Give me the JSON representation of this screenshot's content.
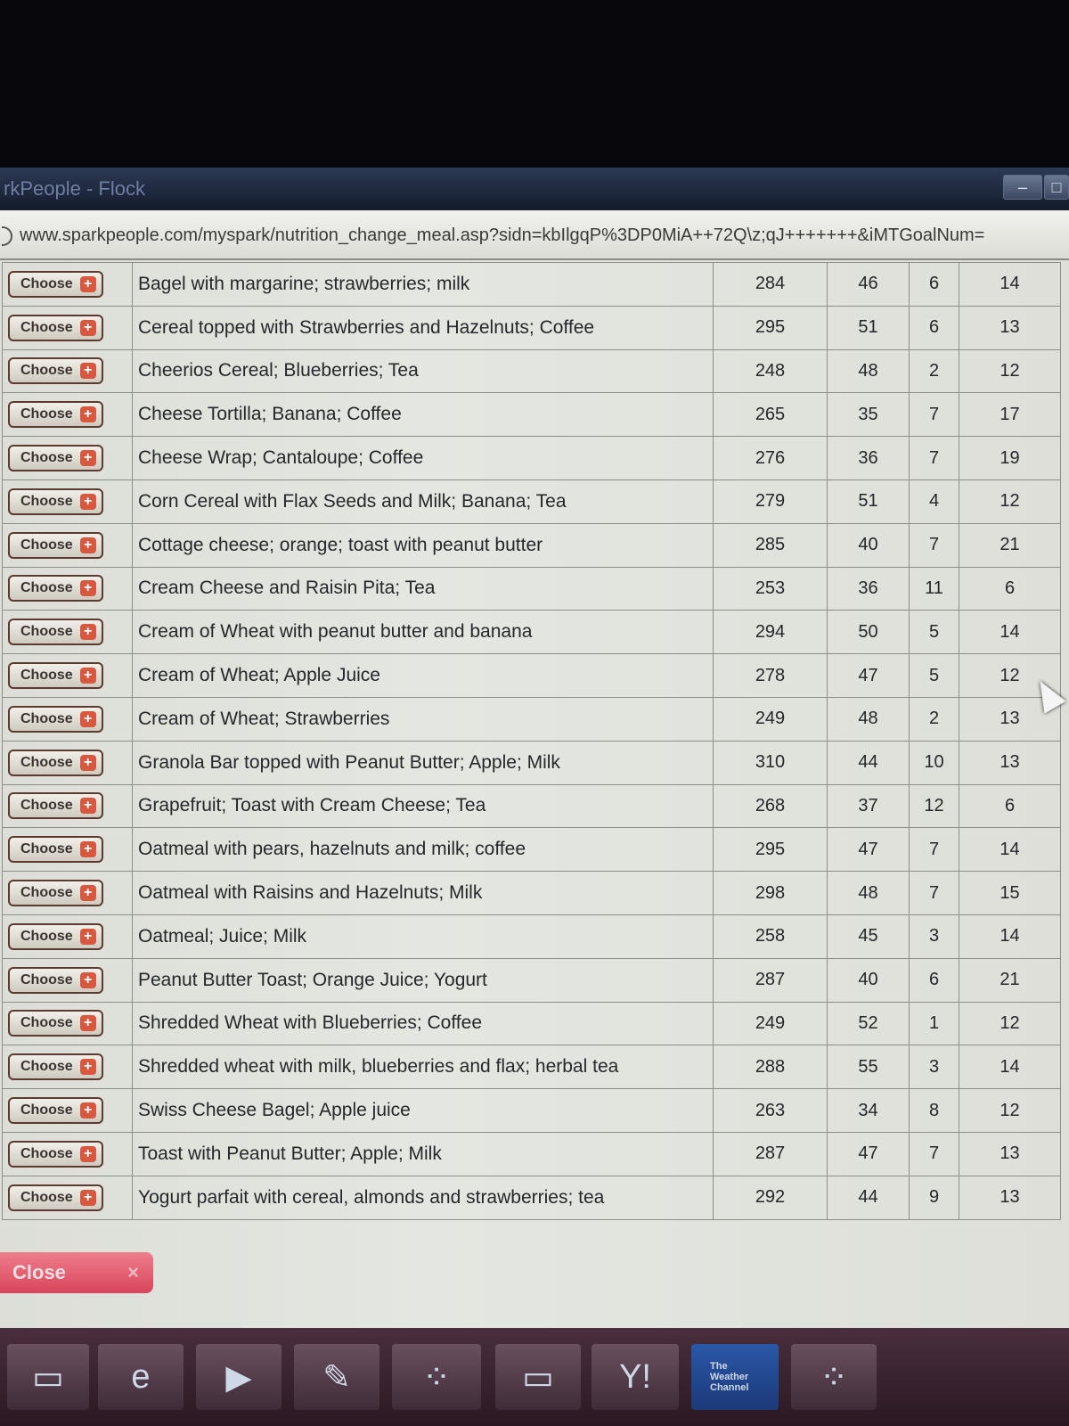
{
  "window": {
    "title": "rkPeople - Flock",
    "controls": [
      "–",
      "□"
    ]
  },
  "address": {
    "url": "www.sparkpeople.com/myspark/nutrition_change_meal.asp?sidn=kbIlgqP%3DP0MiA++72Q\\z;qJ+++++++&iMTGoalNum="
  },
  "table": {
    "choose_label": "Choose",
    "rows": [
      {
        "name": "Bagel with margarine; strawberries; milk",
        "cal": "284",
        "carb": "46",
        "fat": "6",
        "pro": "14"
      },
      {
        "name": "Cereal topped with Strawberries and Hazelnuts; Coffee",
        "cal": "295",
        "carb": "51",
        "fat": "6",
        "pro": "13"
      },
      {
        "name": "Cheerios Cereal; Blueberries; Tea",
        "cal": "248",
        "carb": "48",
        "fat": "2",
        "pro": "12"
      },
      {
        "name": "Cheese Tortilla; Banana; Coffee",
        "cal": "265",
        "carb": "35",
        "fat": "7",
        "pro": "17"
      },
      {
        "name": "Cheese Wrap; Cantaloupe; Coffee",
        "cal": "276",
        "carb": "36",
        "fat": "7",
        "pro": "19"
      },
      {
        "name": "Corn Cereal with Flax Seeds and Milk; Banana; Tea",
        "cal": "279",
        "carb": "51",
        "fat": "4",
        "pro": "12"
      },
      {
        "name": "Cottage cheese; orange; toast with peanut butter",
        "cal": "285",
        "carb": "40",
        "fat": "7",
        "pro": "21"
      },
      {
        "name": "Cream Cheese and Raisin Pita; Tea",
        "cal": "253",
        "carb": "36",
        "fat": "11",
        "pro": "6"
      },
      {
        "name": "Cream of Wheat with peanut butter and banana",
        "cal": "294",
        "carb": "50",
        "fat": "5",
        "pro": "14"
      },
      {
        "name": "Cream of Wheat; Apple Juice",
        "cal": "278",
        "carb": "47",
        "fat": "5",
        "pro": "12"
      },
      {
        "name": "Cream of Wheat; Strawberries",
        "cal": "249",
        "carb": "48",
        "fat": "2",
        "pro": "13"
      },
      {
        "name": "Granola Bar topped with Peanut Butter; Apple; Milk",
        "cal": "310",
        "carb": "44",
        "fat": "10",
        "pro": "13"
      },
      {
        "name": "Grapefruit; Toast with Cream Cheese; Tea",
        "cal": "268",
        "carb": "37",
        "fat": "12",
        "pro": "6"
      },
      {
        "name": "Oatmeal with pears, hazelnuts and milk; coffee",
        "cal": "295",
        "carb": "47",
        "fat": "7",
        "pro": "14"
      },
      {
        "name": "Oatmeal with Raisins and Hazelnuts; Milk",
        "cal": "298",
        "carb": "48",
        "fat": "7",
        "pro": "15"
      },
      {
        "name": "Oatmeal; Juice; Milk",
        "cal": "258",
        "carb": "45",
        "fat": "3",
        "pro": "14"
      },
      {
        "name": "Peanut Butter Toast; Orange Juice; Yogurt",
        "cal": "287",
        "carb": "40",
        "fat": "6",
        "pro": "21"
      },
      {
        "name": "Shredded Wheat with Blueberries; Coffee",
        "cal": "249",
        "carb": "52",
        "fat": "1",
        "pro": "12"
      },
      {
        "name": "Shredded wheat with milk, blueberries and flax; herbal tea",
        "cal": "288",
        "carb": "55",
        "fat": "3",
        "pro": "14"
      },
      {
        "name": "Swiss Cheese Bagel; Apple juice",
        "cal": "263",
        "carb": "34",
        "fat": "8",
        "pro": "12"
      },
      {
        "name": "Toast with Peanut Butter; Apple; Milk",
        "cal": "287",
        "carb": "47",
        "fat": "7",
        "pro": "13"
      },
      {
        "name": "Yogurt parfait with cereal, almonds and strawberries; tea",
        "cal": "292",
        "carb": "44",
        "fat": "9",
        "pro": "13"
      }
    ]
  },
  "footer": {
    "close_label": "Close",
    "close_icon": "×"
  },
  "taskbar": {
    "items": [
      {
        "icon": "folder-icon",
        "glyph": "▭"
      },
      {
        "icon": "internet-explorer-icon",
        "glyph": "e"
      },
      {
        "icon": "media-player-icon",
        "glyph": "▶"
      },
      {
        "icon": "paint-icon",
        "glyph": "✎"
      },
      {
        "icon": "network-icon",
        "glyph": "⁘"
      },
      {
        "icon": "folder-icon",
        "glyph": "▭"
      },
      {
        "icon": "yahoo-messenger-icon",
        "glyph": "Y!"
      },
      {
        "icon": "weather-channel-icon",
        "glyph": "The Weather Channel"
      },
      {
        "icon": "network-icon",
        "glyph": "⁘"
      }
    ]
  },
  "colors": {
    "close_button": "#d9455b",
    "choose_plus": "#d8583f",
    "taskbar": "#3a2230"
  }
}
